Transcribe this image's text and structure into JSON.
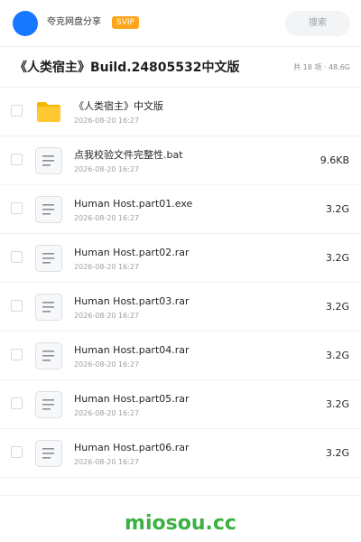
{
  "header": {
    "brand": "夸克网盘分享",
    "badge": "SVIP",
    "search_placeholder": "搜索",
    "brand_color": "#1677ff",
    "badge_color": "#ffa519"
  },
  "share": {
    "title": "《人类宿主》Build.24805532中文版",
    "summary": "共 18 项 · 48.6G"
  },
  "files": [
    {
      "icon": "folder-icon",
      "name": "《人类宿主》中文版",
      "date": "2026-08-20 16:27",
      "size": ""
    },
    {
      "icon": "file-icon",
      "name": "点我校验文件完整性.bat",
      "date": "2026-08-20 16:27",
      "size": "9.6KB"
    },
    {
      "icon": "file-icon",
      "name": "Human Host.part01.exe",
      "date": "2026-08-20 16:27",
      "size": "3.2G"
    },
    {
      "icon": "file-icon",
      "name": "Human Host.part02.rar",
      "date": "2026-08-20 16:27",
      "size": "3.2G"
    },
    {
      "icon": "file-icon",
      "name": "Human Host.part03.rar",
      "date": "2026-08-20 16:27",
      "size": "3.2G"
    },
    {
      "icon": "file-icon",
      "name": "Human Host.part04.rar",
      "date": "2026-08-20 16:27",
      "size": "3.2G"
    },
    {
      "icon": "file-icon",
      "name": "Human Host.part05.rar",
      "date": "2026-08-20 16:27",
      "size": "3.2G"
    },
    {
      "icon": "file-icon",
      "name": "Human Host.part06.rar",
      "date": "2026-08-20 16:27",
      "size": "3.2G"
    }
  ],
  "footer": {
    "watermark": "miosou.cc",
    "watermark_color": "#3cb043"
  }
}
